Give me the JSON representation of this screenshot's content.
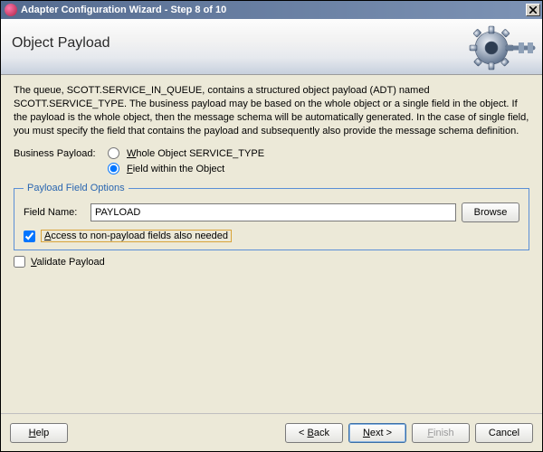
{
  "window": {
    "title": "Adapter Configuration Wizard - Step 8 of 10"
  },
  "banner": {
    "heading": "Object Payload"
  },
  "description": "The queue, SCOTT.SERVICE_IN_QUEUE, contains a structured object payload (ADT) named SCOTT.SERVICE_TYPE. The business payload may be based on the whole object or a single field in the object. If the payload is the whole object, then the message schema will be automatically generated. In the case of single field, you must specify the field that contains the payload and subsequently also provide the message schema definition.",
  "business_payload": {
    "label": "Business Payload:",
    "option_whole_prefix": "W",
    "option_whole_rest": "hole Object SERVICE_TYPE",
    "option_field_prefix": "F",
    "option_field_rest": "ield within the Object",
    "selected": "field"
  },
  "payload_field_options": {
    "legend": "Payload Field Options",
    "field_name_label": "Field Name:",
    "field_name_value": "PAYLOAD",
    "browse_label": "Browse",
    "access_prefix": "A",
    "access_rest": "ccess to non-payload fields also needed",
    "access_checked": true
  },
  "validate": {
    "prefix": "V",
    "rest": "alidate Payload",
    "checked": false
  },
  "footer": {
    "help_prefix": "H",
    "help_rest": "elp",
    "back_prefix": "B",
    "back_rest": "ack",
    "next_prefix": "N",
    "next_rest": "ext",
    "finish_prefix": "F",
    "finish_rest": "inish",
    "cancel": "Cancel"
  }
}
